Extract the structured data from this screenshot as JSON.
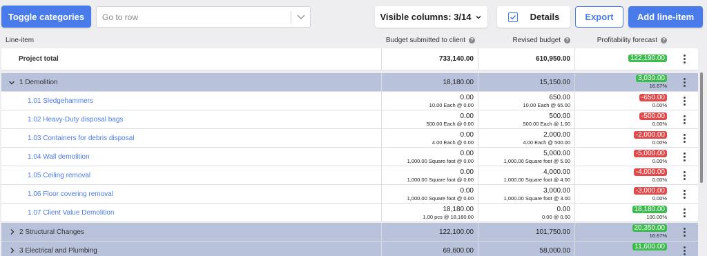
{
  "toolbar": {
    "toggle_label": "Toggle categories",
    "goto_placeholder": "Go to row",
    "visible_columns_label": "Visible columns: 3/14",
    "details_label": "Details",
    "export_label": "Export",
    "add_label": "Add line-item",
    "accent_color": "#4a7bea"
  },
  "columns": {
    "line_item": "Line-item",
    "budget": "Budget submitted to client",
    "revised": "Revised budget",
    "profit": "Profitability forecast"
  },
  "total": {
    "label": "Project total",
    "budget": "733,140.00",
    "revised": "610,950.00",
    "profit": "122,190.00"
  },
  "categories": [
    {
      "label": "1 Demolition",
      "budget": "18,180.00",
      "revised": "15,150.00",
      "profit": "3,030.00",
      "percent": "16.67%",
      "expanded": true
    },
    {
      "label": "2 Structural Changes",
      "budget": "122,100.00",
      "revised": "101,750.00",
      "profit": "20,350.00",
      "percent": "16.67%",
      "expanded": false
    },
    {
      "label": "3 Electrical and Plumbing",
      "budget": "69,600.00",
      "revised": "58,000.00",
      "profit": "11,600.00",
      "percent": "",
      "expanded": false
    }
  ],
  "items": [
    {
      "label": "1.01 Sledgehammers",
      "budget": "0.00",
      "budget_sub": "10.00 Each @ 0.00",
      "revised": "650.00",
      "revised_sub": "10.00 Each @ 65.00",
      "profit": "-650.00",
      "percent": "0.00%",
      "status": "red"
    },
    {
      "label": "1.02 Heavy-Duty disposal bags",
      "budget": "0.00",
      "budget_sub": "500.00 Each @ 0.00",
      "revised": "500.00",
      "revised_sub": "500.00 Each @ 1.00",
      "profit": "-500.00",
      "percent": "0.00%",
      "status": "red"
    },
    {
      "label": "1.03 Containers for debris disposal",
      "budget": "0.00",
      "budget_sub": "4.00 Each @ 0.00",
      "revised": "2,000.00",
      "revised_sub": "4.00 Each @ 500.00",
      "profit": "-2,000.00",
      "percent": "0.00%",
      "status": "red"
    },
    {
      "label": "1.04 Wall demolition",
      "budget": "0.00",
      "budget_sub": "1,000.00 Square foot @ 0.00",
      "revised": "5,000.00",
      "revised_sub": "1,000.00 Square foot @ 5.00",
      "profit": "-5,000.00",
      "percent": "0.00%",
      "status": "red"
    },
    {
      "label": "1.05 Ceiling removal",
      "budget": "0.00",
      "budget_sub": "1,000.00 Square foot @ 0.00",
      "revised": "4,000.00",
      "revised_sub": "1,000.00 Square foot @ 4.00",
      "profit": "-4,000.00",
      "percent": "0.00%",
      "status": "red"
    },
    {
      "label": "1.06 Floor covering removal",
      "budget": "0.00",
      "budget_sub": "1,000.00 Square foot @ 0.00",
      "revised": "3,000.00",
      "revised_sub": "1,000.00 Square foot @ 3.00",
      "profit": "-3,000.00",
      "percent": "0.00%",
      "status": "red"
    },
    {
      "label": "1.07 Client Value Demolition",
      "budget": "18,180.00",
      "budget_sub": "1.00 pcs @ 18,180.00",
      "revised": "0.00",
      "revised_sub": "0.00 @ 0.00",
      "profit": "18,180.00",
      "percent": "100.00%",
      "status": "green"
    }
  ]
}
